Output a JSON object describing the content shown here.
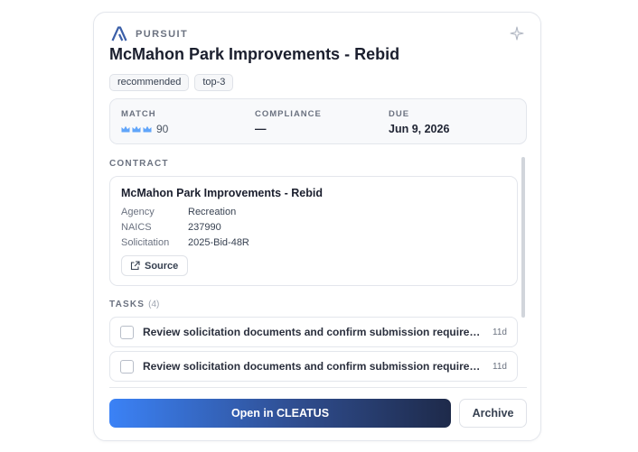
{
  "header": {
    "brand_label": "PURSUIT",
    "logo_icon": "arrow-a-logo-icon",
    "sparkle_icon": "sparkle-icon",
    "title": "McMahon Park Improvements - Rebid"
  },
  "tags": [
    "recommended",
    "top-3"
  ],
  "stats": {
    "match": {
      "label": "MATCH",
      "icon": "crown-icon",
      "icon_count": 3,
      "value": "90"
    },
    "compliance": {
      "label": "COMPLIANCE",
      "value": "—"
    },
    "due": {
      "label": "DUE",
      "value": "Jun 9, 2026"
    }
  },
  "contract": {
    "section_label": "CONTRACT",
    "title": "McMahon Park Improvements - Rebid",
    "fields": [
      {
        "key": "Agency",
        "value": "Recreation"
      },
      {
        "key": "NAICS",
        "value": "237990"
      },
      {
        "key": "Solicitation",
        "value": "2025-Bid-48R"
      }
    ],
    "source_label": "Source",
    "source_icon": "external-link-icon"
  },
  "tasks": {
    "section_label": "TASKS",
    "count": "(4)",
    "items": [
      {
        "text": "Review solicitation documents and confirm submission requirements",
        "due": "11d"
      },
      {
        "text": "Review solicitation documents and confirm submission requirements",
        "due": "11d"
      }
    ]
  },
  "actions": {
    "open_label": "Open in CLEATUS",
    "archive_label": "Archive"
  },
  "colors": {
    "accent_start": "#3b82f6",
    "accent_end": "#1e2a4a",
    "crown": "#60a5fa"
  }
}
